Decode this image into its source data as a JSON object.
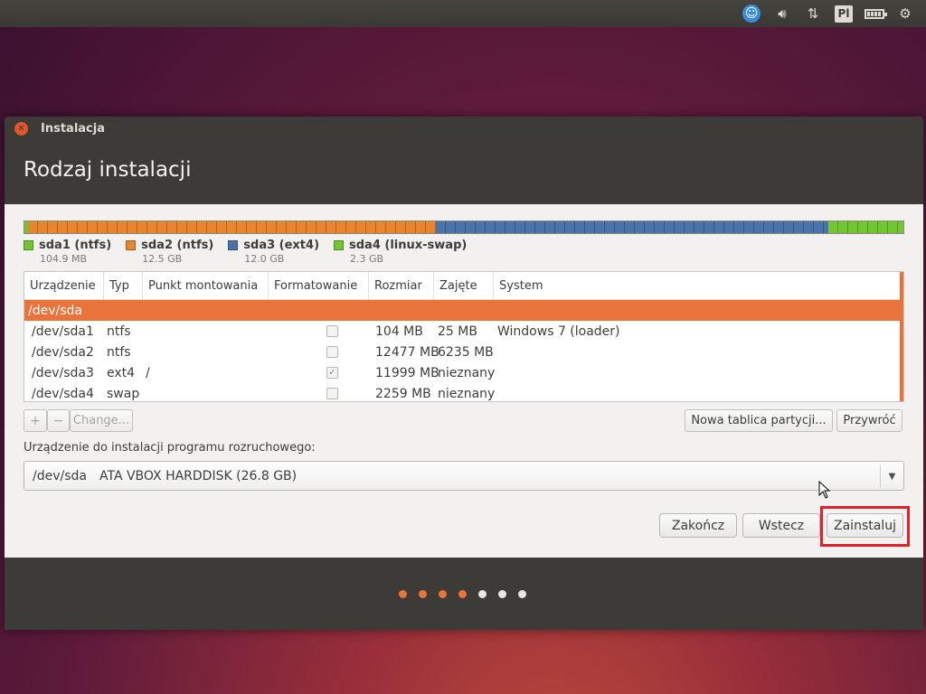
{
  "top_panel": {
    "icons": [
      "accessibility-icon",
      "volume-icon",
      "network-icon",
      "keyboard-layout-icon",
      "battery-icon",
      "settings-gear-icon"
    ],
    "keyboard_layout": "Pl"
  },
  "window": {
    "title": "Instalacja",
    "page_title": "Rodzaj instalacji"
  },
  "partition_bar": {
    "segments": [
      {
        "name": "sda1",
        "color": "#73c631",
        "fraction": 0.004
      },
      {
        "name": "sda2",
        "color": "#e8862f",
        "fraction": 0.466
      },
      {
        "name": "sda3",
        "color": "#4a74a8",
        "fraction": 0.447
      },
      {
        "name": "sda4",
        "color": "#73c631",
        "fraction": 0.086
      }
    ]
  },
  "legend": [
    {
      "label": "sda1 (ntfs)",
      "size": "104.9 MB",
      "color": "#73c631"
    },
    {
      "label": "sda2 (ntfs)",
      "size": "12.5 GB",
      "color": "#e8862f"
    },
    {
      "label": "sda3 (ext4)",
      "size": "12.0 GB",
      "color": "#4a74a8"
    },
    {
      "label": "sda4 (linux-swap)",
      "size": "2.3 GB",
      "color": "#73c631"
    }
  ],
  "table": {
    "headers": [
      "Urządzenie",
      "Typ",
      "Punkt montowania",
      "Formatowanie",
      "Rozmiar",
      "Zajęte",
      "System"
    ],
    "selected_row": "/dev/sda",
    "rows": [
      {
        "device": "/dev/sda1",
        "type": "ntfs",
        "mount": "",
        "format": false,
        "size": "104 MB",
        "used": "25 MB",
        "system": "Windows 7 (loader)"
      },
      {
        "device": "/dev/sda2",
        "type": "ntfs",
        "mount": "",
        "format": false,
        "size": "12477 MB",
        "used": "6235 MB",
        "system": ""
      },
      {
        "device": "/dev/sda3",
        "type": "ext4",
        "mount": "/",
        "format": true,
        "size": "11999 MB",
        "used": "nieznany",
        "system": ""
      },
      {
        "device": "/dev/sda4",
        "type": "swap",
        "mount": "",
        "format": false,
        "size": "2259 MB",
        "used": "nieznany",
        "system": ""
      }
    ]
  },
  "toolbar": {
    "add": "+",
    "remove": "−",
    "change": "Change...",
    "new_table": "Nowa tablica partycji...",
    "revert": "Przywróć"
  },
  "bootloader": {
    "label": "Urządzenie do instalacji programu rozruchowego:",
    "device": "/dev/sda",
    "description": "ATA VBOX HARDDISK (26.8 GB)"
  },
  "buttons": {
    "quit": "Zakończ",
    "back": "Wstecz",
    "install": "Zainstaluj"
  },
  "progress": {
    "total_steps": 7,
    "completed_steps": 4,
    "active_color": "#e8743c",
    "inactive_color": "#e9e7e2"
  }
}
